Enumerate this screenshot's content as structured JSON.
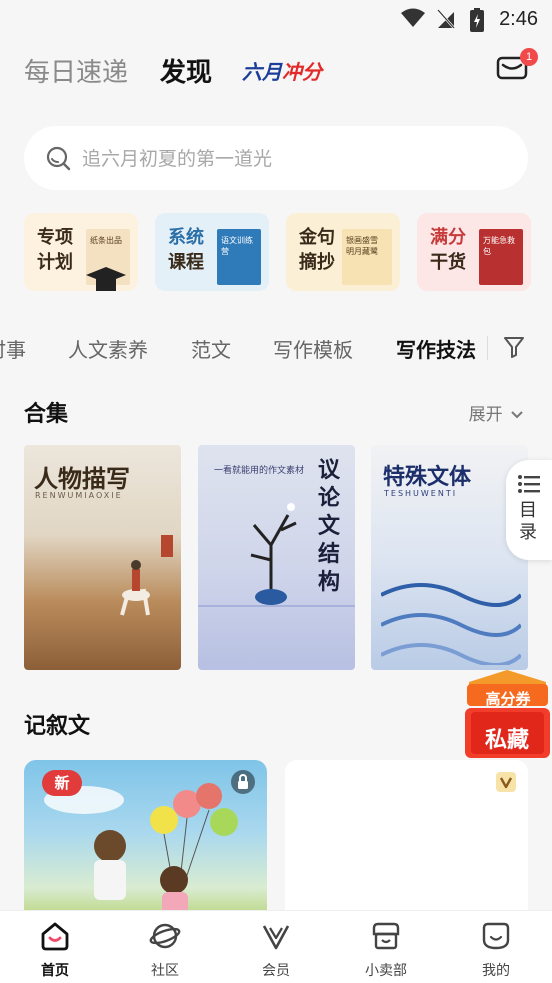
{
  "status": {
    "time": "2:46"
  },
  "header": {
    "tabs": [
      {
        "label": "每日速递",
        "active": false
      },
      {
        "label": "发现",
        "active": true
      }
    ],
    "promo_part1": "六月",
    "promo_part2": "冲分",
    "mail_badge": "1"
  },
  "search": {
    "placeholder": "追六月初夏的第一道光"
  },
  "quick_cards": [
    {
      "line1": "专项",
      "line2": "计划",
      "book_text": "纸条出品",
      "bg": "#fdf1df",
      "accent": "#3a2a1a"
    },
    {
      "line1": "系统",
      "line2": "课程",
      "book_text": "语文训练营",
      "bg": "#e3f0f7",
      "accent": "#2b6fa7"
    },
    {
      "line1": "金句",
      "line2": "摘抄",
      "book_text": "银画盛雪 明月藏鹭",
      "bg": "#fbefd6",
      "accent": "#3a2a1a"
    },
    {
      "line1": "满分",
      "line2": "干货",
      "book_text": "万能急救包",
      "bg": "#fce6e6",
      "accent": "#c73a3a"
    }
  ],
  "categories": {
    "items": [
      "时事",
      "人文素养",
      "范文",
      "写作模板",
      "写作技法"
    ],
    "active": "写作技法"
  },
  "collections": {
    "title": "合集",
    "expand_label": "展开",
    "covers": [
      {
        "title": "人物描写",
        "subtitle": "RENWUMIAOXIE"
      },
      {
        "title": "议论文结构",
        "caption": "一看就能用的作文素材"
      },
      {
        "title": "特殊文体",
        "subtitle": "TESHUWENTI"
      }
    ]
  },
  "toc_label": "目录",
  "coupon": {
    "top": "高分券",
    "bottom": "私藏"
  },
  "narrative": {
    "title": "记叙文",
    "badge_new": "新"
  },
  "bottom_nav": [
    {
      "label": "首页",
      "active": true
    },
    {
      "label": "社区",
      "active": false
    },
    {
      "label": "会员",
      "active": false
    },
    {
      "label": "小卖部",
      "active": false
    },
    {
      "label": "我的",
      "active": false
    }
  ]
}
